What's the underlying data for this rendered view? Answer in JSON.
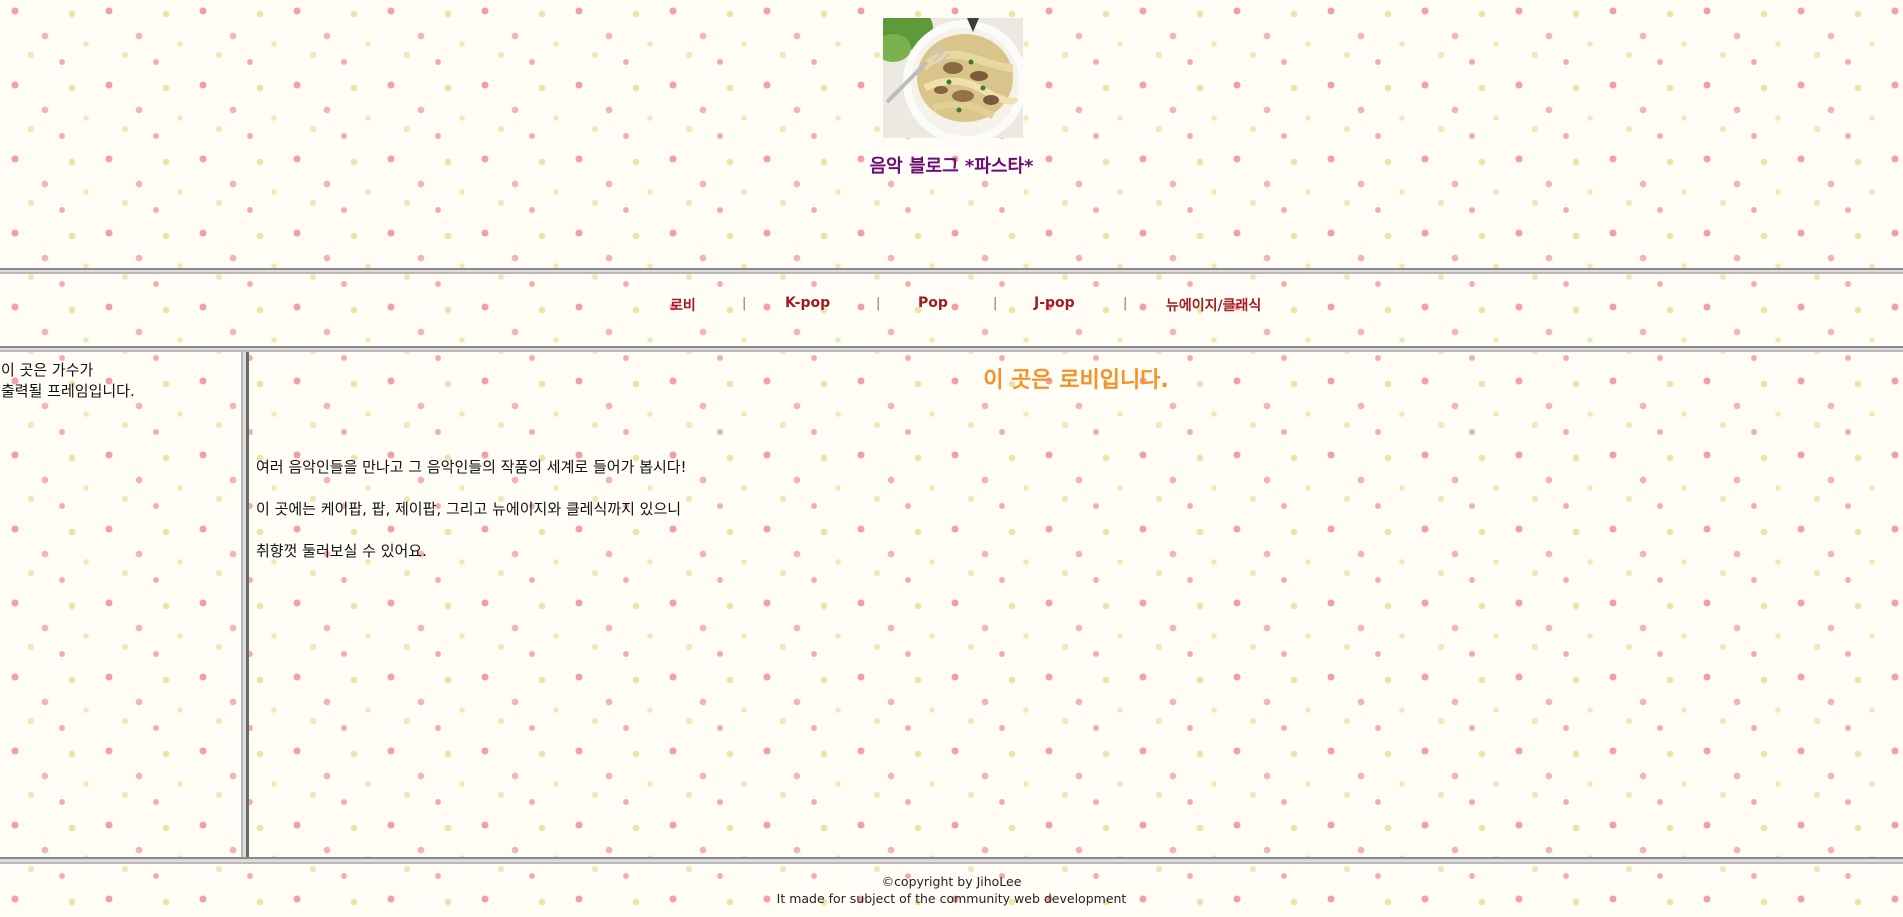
{
  "header": {
    "image_alt": "pasta dish photo",
    "title": "음악 블로그 *파스타*",
    "title_color": "#6a0d76"
  },
  "nav": {
    "items": [
      {
        "label": "로비"
      },
      {
        "label": "K-pop"
      },
      {
        "label": "Pop"
      },
      {
        "label": "J-pop"
      },
      {
        "label": "뉴에이지/클래식"
      }
    ],
    "separator": "|",
    "link_color": "#a11b22"
  },
  "side": {
    "text": "이 곳은 가수가\n출력될 프레임입니다."
  },
  "main": {
    "heading": "이 곳은 로비입니다.",
    "heading_color": "#f5922a",
    "paragraphs": [
      "여러 음악인들을 만나고 그 음악인들의 작품의 세계로 들어가 봅시다!",
      "이 곳에는 케이팝, 팝, 제이팝, 그리고 뉴에이지와 클레식까지 있으니",
      "취향껏 둘러보실 수 있어요."
    ]
  },
  "footer": {
    "copyright": "©copyright by JihoLee",
    "note": "It made for subject of the community web development"
  }
}
